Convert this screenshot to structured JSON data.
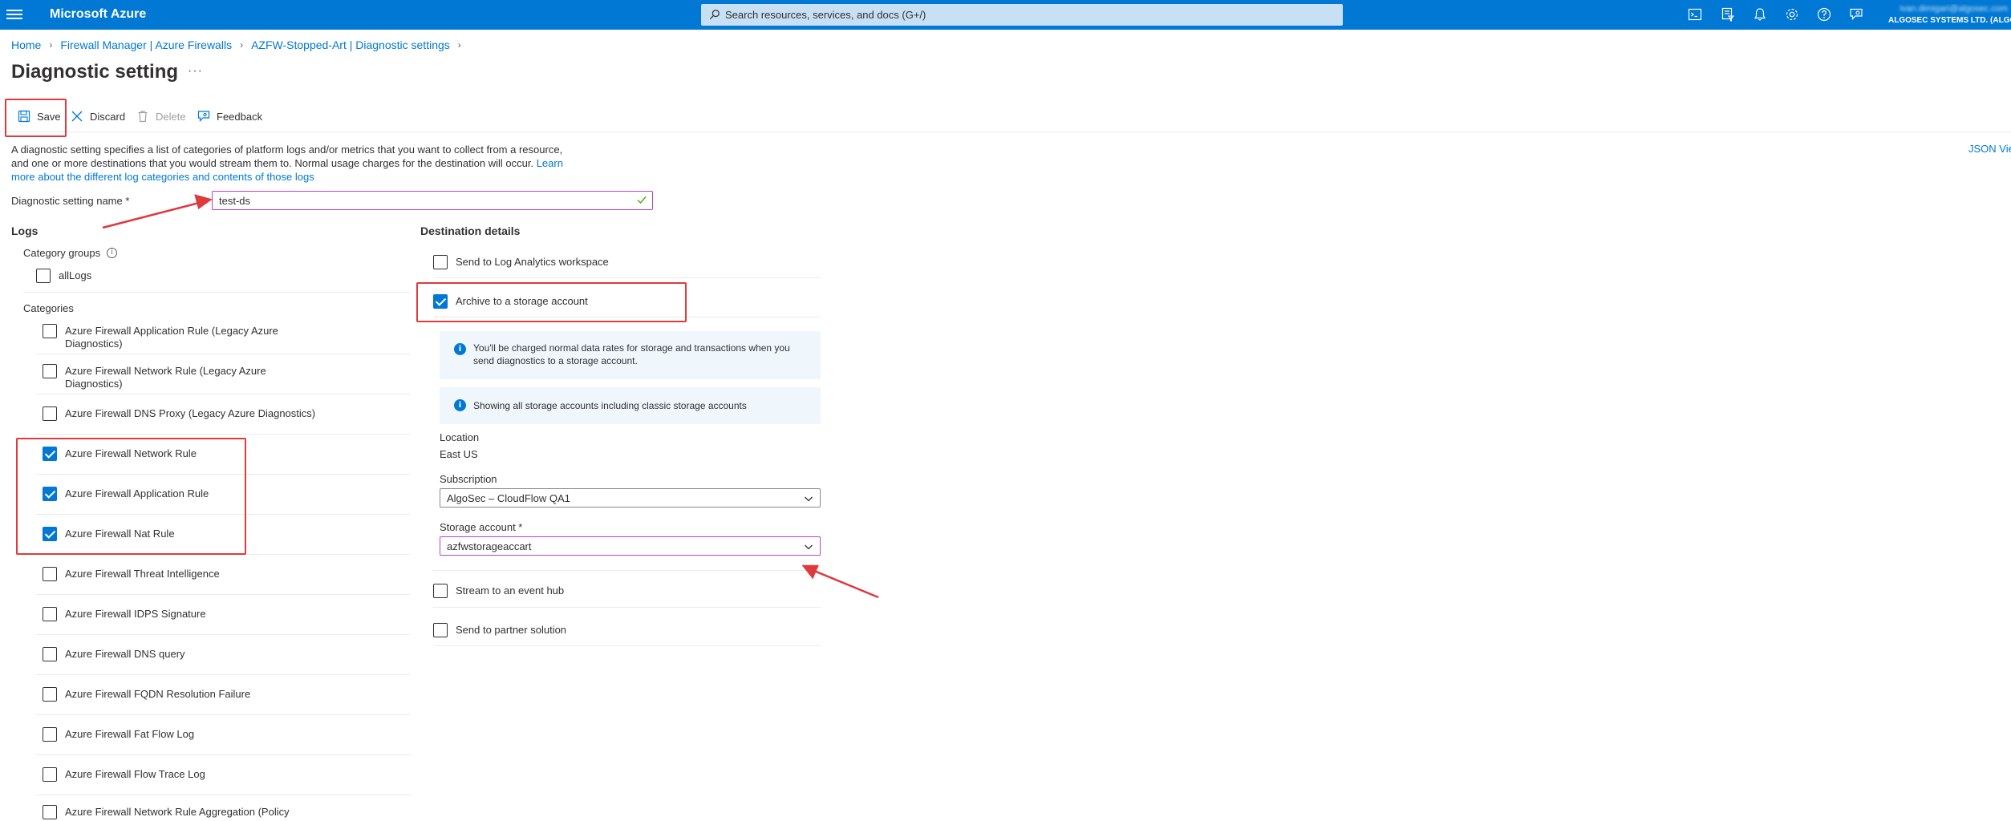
{
  "topbar": {
    "brand": "Microsoft Azure",
    "search_placeholder": "Search resources, services, and docs (G+/)",
    "icons": [
      "cloud-shell-icon",
      "directory-filter-icon",
      "notifications-icon",
      "settings-icon",
      "help-icon",
      "feedback-icon"
    ],
    "account_email": "ivan.dimigari@algosec.com",
    "account_tenant": "ALGOSEC SYSTEMS LTD. (ALGOSEC"
  },
  "breadcrumb": {
    "items": [
      "Home",
      "Firewall Manager | Azure Firewalls",
      "AZFW-Stopped-Art | Diagnostic settings"
    ]
  },
  "page": {
    "title": "Diagnostic setting",
    "more": "···"
  },
  "toolbar": {
    "save": "Save",
    "discard": "Discard",
    "delete": "Delete",
    "feedback": "Feedback"
  },
  "description": {
    "line1": "A diagnostic setting specifies a list of categories of platform logs and/or metrics that you want to collect from a resource,",
    "line2": "and one or more destinations that you would stream them to. Normal usage charges for the destination will occur.",
    "link_part1": "Learn",
    "link_part2": "more about the different log categories and contents of those logs",
    "json_view": "JSON View"
  },
  "setting_name": {
    "label": "Diagnostic setting name *",
    "value": "test-ds"
  },
  "logs": {
    "heading": "Logs",
    "category_groups_label": "Category groups",
    "category_groups": [
      {
        "label": "allLogs",
        "checked": false
      }
    ],
    "categories_label": "Categories",
    "categories": [
      {
        "label": "Azure Firewall Application Rule (Legacy Azure Diagnostics)",
        "checked": false
      },
      {
        "label": "Azure Firewall Network Rule (Legacy Azure Diagnostics)",
        "checked": false
      },
      {
        "label": "Azure Firewall DNS Proxy (Legacy Azure Diagnostics)",
        "checked": false
      },
      {
        "label": "Azure Firewall Network Rule",
        "checked": true
      },
      {
        "label": "Azure Firewall Application Rule",
        "checked": true
      },
      {
        "label": "Azure Firewall Nat Rule",
        "checked": true
      },
      {
        "label": "Azure Firewall Threat Intelligence",
        "checked": false
      },
      {
        "label": "Azure Firewall IDPS Signature",
        "checked": false
      },
      {
        "label": "Azure Firewall DNS query",
        "checked": false
      },
      {
        "label": "Azure Firewall FQDN Resolution Failure",
        "checked": false
      },
      {
        "label": "Azure Firewall Fat Flow Log",
        "checked": false
      },
      {
        "label": "Azure Firewall Flow Trace Log",
        "checked": false
      },
      {
        "label": "Azure Firewall Network Rule Aggregation (Policy",
        "checked": false
      }
    ]
  },
  "destination": {
    "heading": "Destination details",
    "log_analytics": {
      "label": "Send to Log Analytics workspace",
      "checked": false
    },
    "storage": {
      "label": "Archive to a storage account",
      "checked": true
    },
    "info1": "You'll be charged normal data rates for storage and transactions when you send diagnostics to a storage account.",
    "info2": "Showing all storage accounts including classic storage accounts",
    "location_label": "Location",
    "location_value": "East US",
    "subscription_label": "Subscription",
    "subscription_value": "AlgoSec – CloudFlow QA1",
    "storage_account_label": "Storage account *",
    "storage_account_value": "azfwstorageaccart",
    "event_hub": {
      "label": "Stream to an event hub",
      "checked": false
    },
    "partner": {
      "label": "Send to partner solution",
      "checked": false
    }
  },
  "colors": {
    "brand_blue": "#0078d4",
    "annotation_red": "#e0393e",
    "focus_purple": "#b146c2"
  }
}
